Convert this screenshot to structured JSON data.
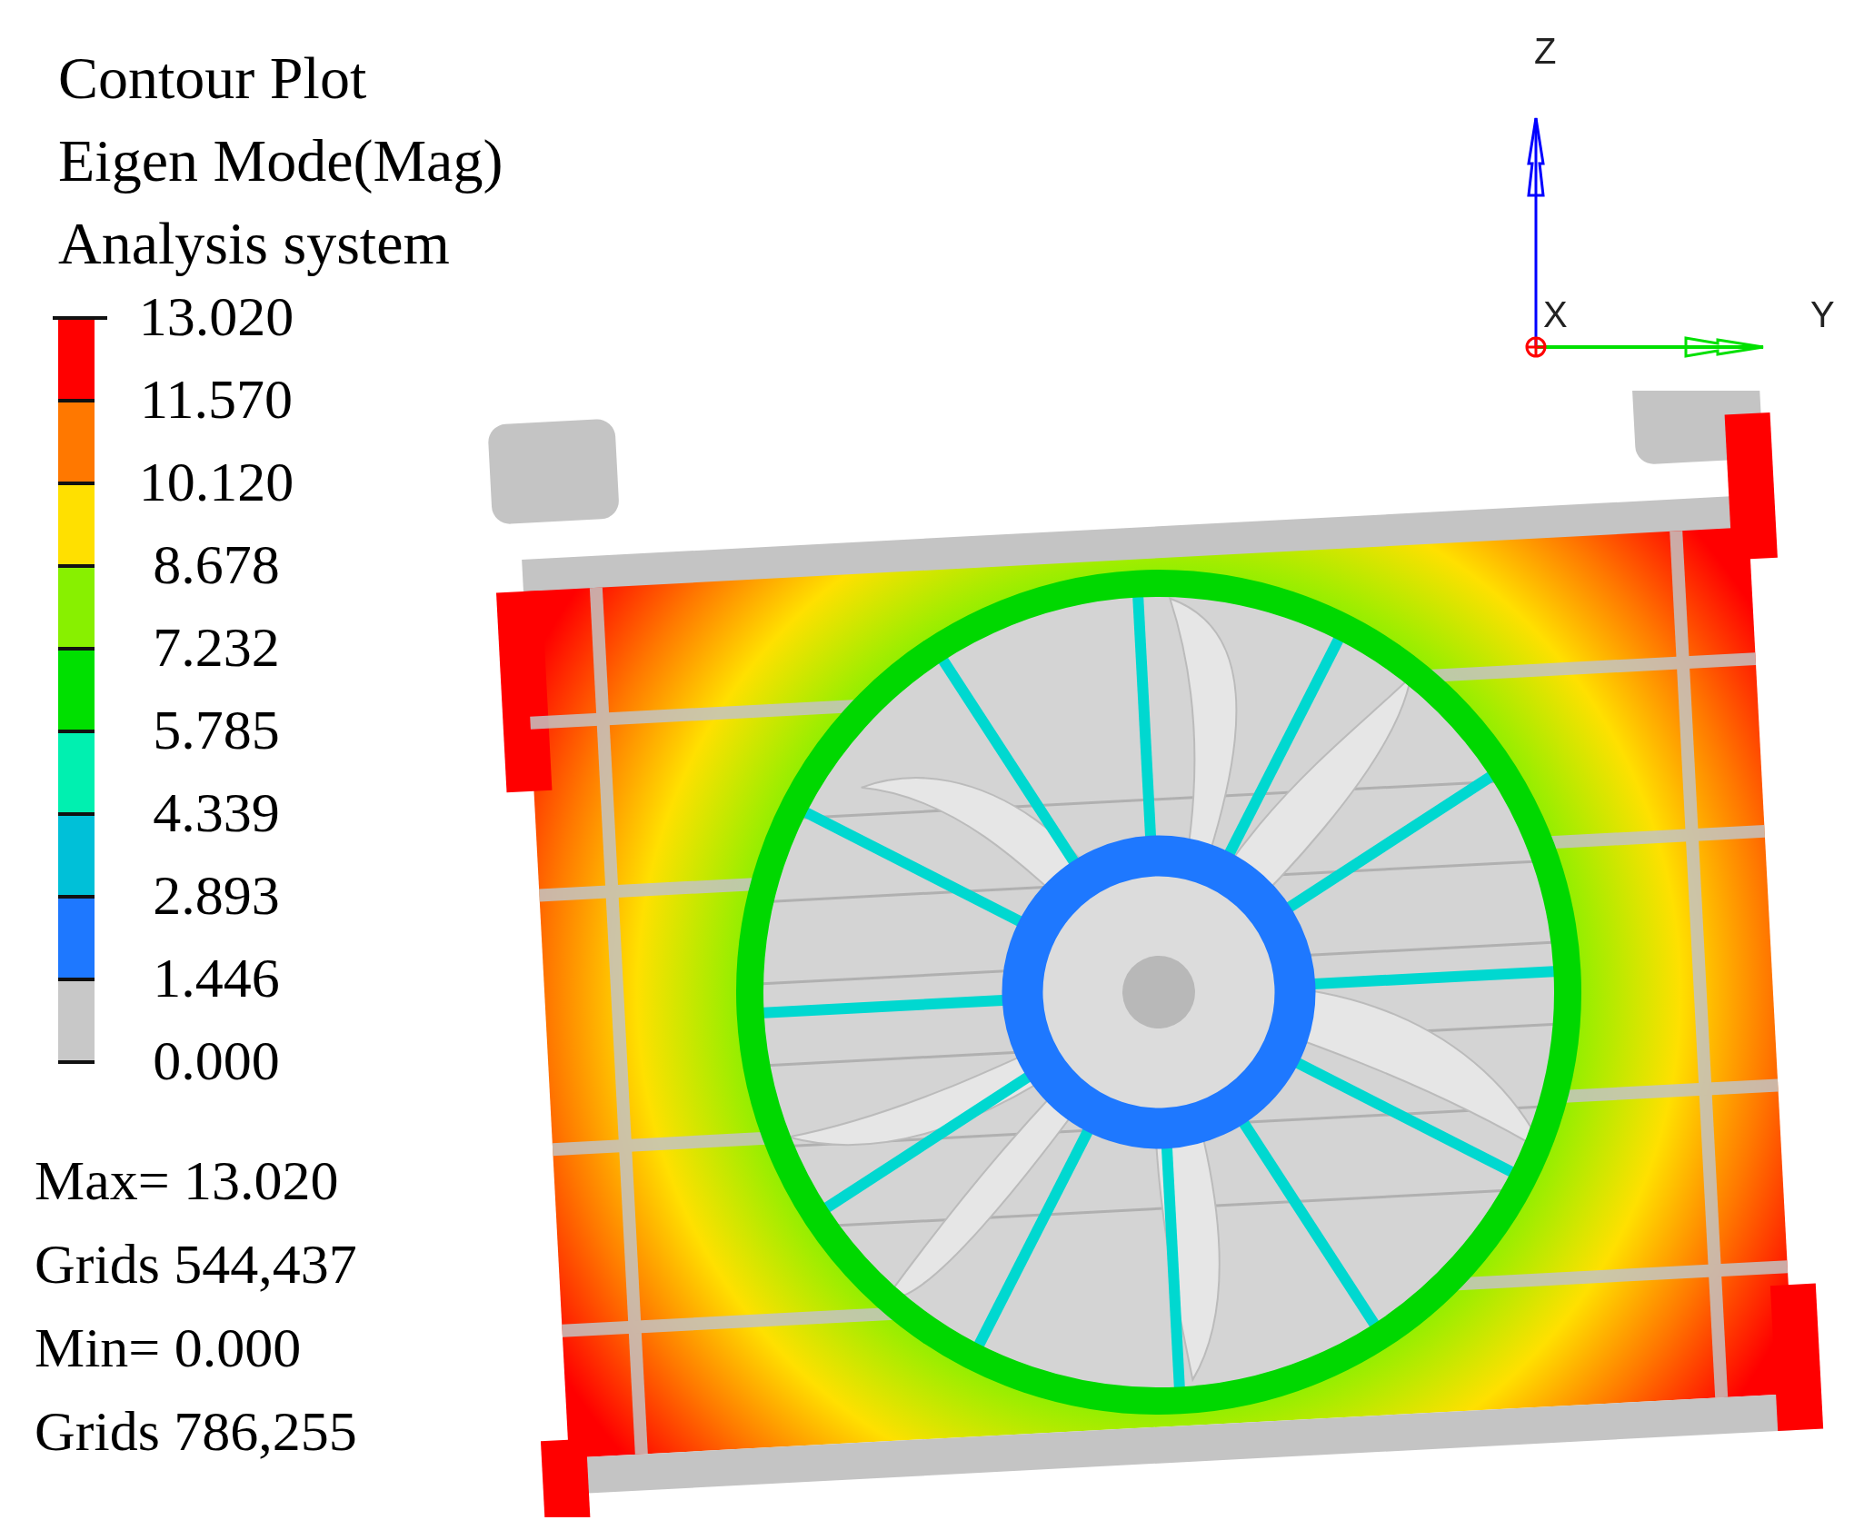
{
  "title_lines": [
    "Contour Plot",
    "Eigen Mode(Mag)",
    "Analysis system"
  ],
  "legend": {
    "ticks": [
      "13.020",
      "11.570",
      "10.120",
      "8.678",
      "7.232",
      "5.785",
      "4.339",
      "2.893",
      "1.446",
      "0.000"
    ],
    "bands": [
      {
        "color": "#ff0000"
      },
      {
        "color": "#ff7800"
      },
      {
        "color": "#ffe000"
      },
      {
        "color": "#88f000"
      },
      {
        "color": "#00e000"
      },
      {
        "color": "#00f0b0"
      },
      {
        "color": "#00c0d8"
      },
      {
        "color": "#1e78ff"
      },
      {
        "color": "#c8c8c8"
      }
    ]
  },
  "stats": [
    "Max= 13.020",
    "Grids 544,437",
    "Min= 0.000",
    "Grids 786,255"
  ],
  "triad": {
    "z_label": "Z",
    "x_label": "X",
    "y_label": "Y"
  }
}
